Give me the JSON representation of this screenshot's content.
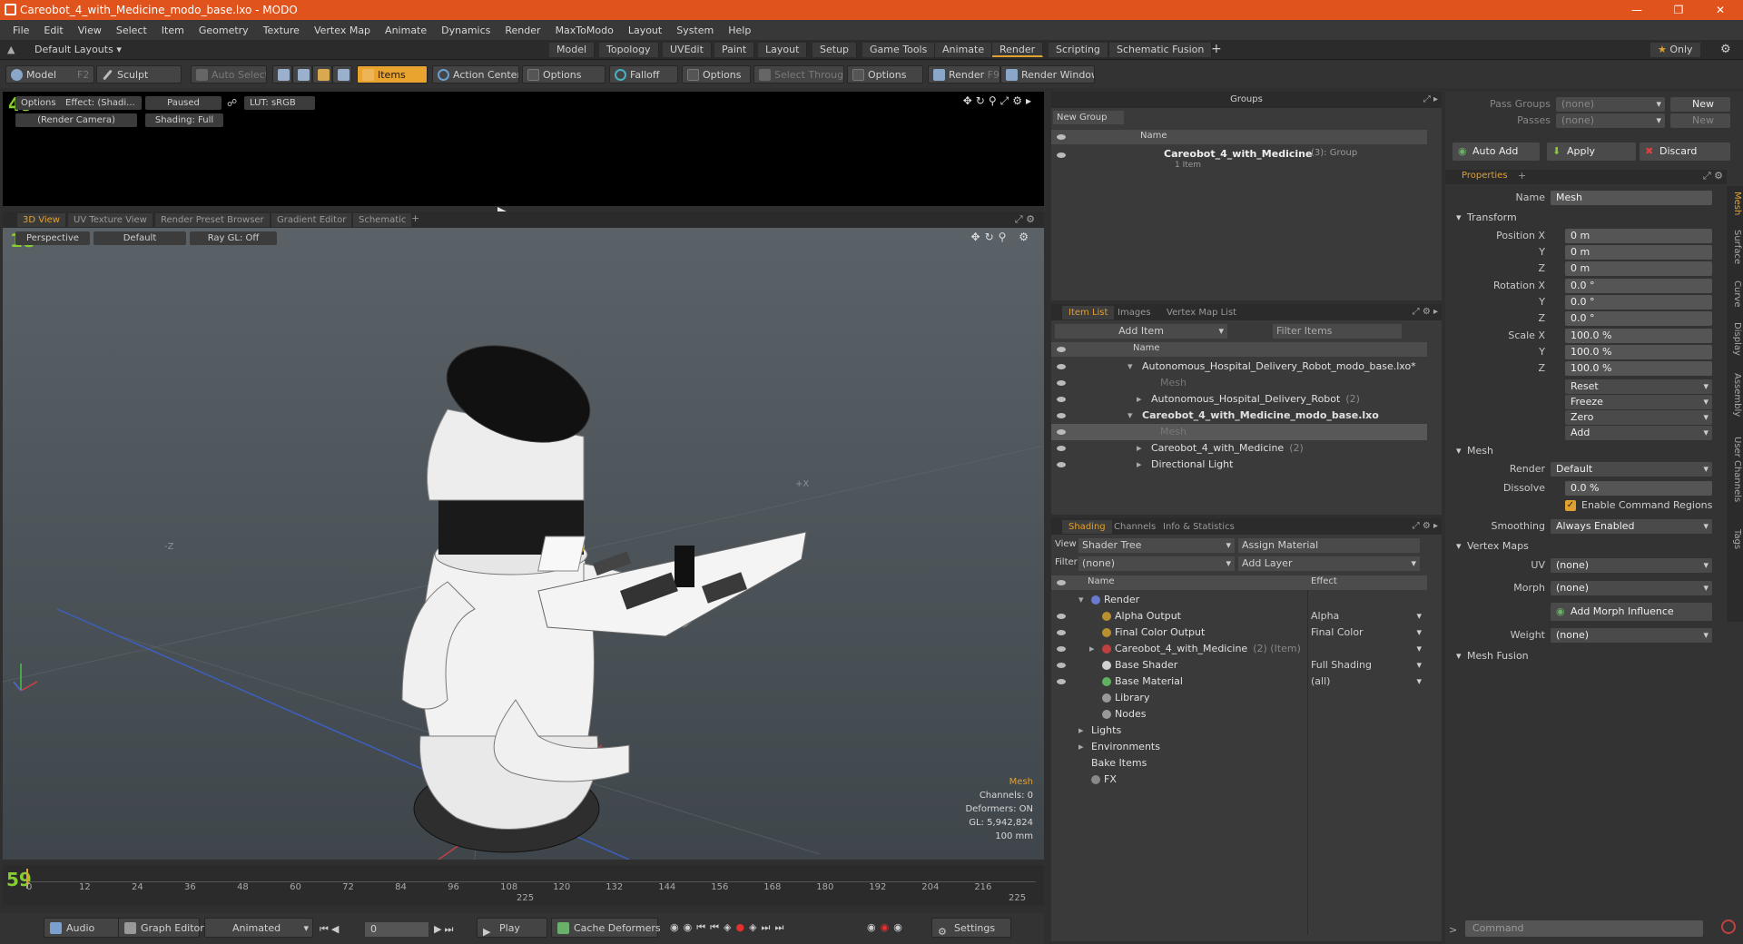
{
  "app": {
    "title": "Careobot_4_with_Medicine_modo_base.lxo - MODO",
    "menu": [
      "File",
      "Edit",
      "View",
      "Select",
      "Item",
      "Geometry",
      "Texture",
      "Vertex Map",
      "Animate",
      "Dynamics",
      "Render",
      "MaxToModo",
      "Layout",
      "System",
      "Help"
    ]
  },
  "layout": {
    "preset": "Default Layouts",
    "tabs": [
      "Model",
      "Topology",
      "UVEdit",
      "Paint",
      "Layout",
      "Setup",
      "Game Tools",
      "Animate",
      "Render",
      "Scripting",
      "Schematic Fusion"
    ],
    "active_tab": "Render",
    "only_label": "Only"
  },
  "toolbar": {
    "model": "Model",
    "model_key": "F2",
    "sculpt": "Sculpt",
    "auto_select": "Auto Select",
    "items": "Items",
    "action_center": "Action Center",
    "options1": "Options",
    "falloff": "Falloff",
    "options2": "Options",
    "select_through": "Select Through",
    "options3": "Options",
    "render": "Render",
    "render_key": "F9",
    "render_window": "Render Window"
  },
  "render_preview": {
    "options": "Options",
    "effect": "Effect: (Shadi...",
    "status": "Paused",
    "lut": "LUT: sRGB",
    "camera": "(Render Camera)",
    "shading": "Shading: Full",
    "frame_counter": "49"
  },
  "viewport_tabs": [
    "3D View",
    "UV Texture View",
    "Render Preset Browser",
    "Gradient Editor",
    "Schematic"
  ],
  "viewport": {
    "projection": "Perspective",
    "style": "Default",
    "raygl": "Ray GL: Off",
    "frame_counter": "18",
    "axis_z": "-Z",
    "axis_x": "+X",
    "stats": {
      "title": "Mesh",
      "channels": "Channels: 0",
      "deformers": "Deformers: ON",
      "gl": "GL: 5,942,824",
      "scale": "100 mm"
    }
  },
  "timeline": {
    "ticks": [
      "0",
      "12",
      "24",
      "36",
      "48",
      "60",
      "72",
      "84",
      "96",
      "108",
      "120",
      "132",
      "144",
      "156",
      "168",
      "180",
      "192",
      "204",
      "216"
    ],
    "end_mid": "225",
    "end_right": "225",
    "counter": "59"
  },
  "bottombar": {
    "audio": "Audio",
    "graph_editor": "Graph Editor",
    "animated": "Animated",
    "frame": "0",
    "play": "Play",
    "cache_deformers": "Cache Deformers",
    "settings": "Settings"
  },
  "groups": {
    "title": "Groups",
    "new_group": "New Group",
    "col_name": "Name",
    "item_name": "Careobot_4_with_Medicine",
    "item_count": "(3)",
    "item_type": ": Group",
    "item_sub": "1 Item"
  },
  "itemlist": {
    "tabs": [
      "Item List",
      "Images",
      "Vertex Map List"
    ],
    "add_item": "Add Item",
    "filter": "Filter Items",
    "col_name": "Name",
    "rows": [
      {
        "label": "Autonomous_Hospital_Delivery_Robot_modo_base.lxo*",
        "extra": "",
        "indent": 0,
        "bold": false,
        "selected": false,
        "dim": false
      },
      {
        "label": "Mesh",
        "extra": "",
        "indent": 2,
        "bold": false,
        "selected": false,
        "dim": true
      },
      {
        "label": "Autonomous_Hospital_Delivery_Robot",
        "extra": "(2)",
        "indent": 1,
        "bold": false,
        "selected": false,
        "dim": false
      },
      {
        "label": "Careobot_4_with_Medicine_modo_base.lxo",
        "extra": "",
        "indent": 0,
        "bold": true,
        "selected": false,
        "dim": false
      },
      {
        "label": "Mesh",
        "extra": "",
        "indent": 2,
        "bold": false,
        "selected": true,
        "dim": true
      },
      {
        "label": "Careobot_4_with_Medicine",
        "extra": "(2)",
        "indent": 1,
        "bold": false,
        "selected": false,
        "dim": false
      },
      {
        "label": "Directional Light",
        "extra": "",
        "indent": 1,
        "bold": false,
        "selected": false,
        "dim": false
      }
    ]
  },
  "shading": {
    "tabs": [
      "Shading",
      "Channels",
      "Info & Statistics"
    ],
    "view_label": "View",
    "view_value": "Shader Tree",
    "assign_material": "Assign Material",
    "filter_label": "Filter",
    "filter_value": "(none)",
    "add_layer": "Add Layer",
    "col_name": "Name",
    "col_effect": "Effect",
    "rows": [
      {
        "label": "Render",
        "effect": "",
        "indent": 0,
        "icon": "#6a7ad0"
      },
      {
        "label": "Alpha Output",
        "effect": "Alpha",
        "indent": 1,
        "icon": "#b89030"
      },
      {
        "label": "Final Color Output",
        "effect": "Final Color",
        "indent": 1,
        "icon": "#b89030"
      },
      {
        "label": "Careobot_4_with_Medicine",
        "extra": "(2) (Item)",
        "effect": "",
        "indent": 1,
        "icon": "#c04040"
      },
      {
        "label": "Base Shader",
        "effect": "Full Shading",
        "indent": 1,
        "icon": "#d0d0d0"
      },
      {
        "label": "Base Material",
        "effect": "(all)",
        "indent": 1,
        "icon": "#60b060"
      },
      {
        "label": "Library",
        "effect": "",
        "indent": 1,
        "icon": "#999"
      },
      {
        "label": "Nodes",
        "effect": "",
        "indent": 1,
        "icon": "#999"
      },
      {
        "label": "Lights",
        "effect": "",
        "indent": 0,
        "icon": ""
      },
      {
        "label": "Environments",
        "effect": "",
        "indent": 0,
        "icon": ""
      },
      {
        "label": "Bake Items",
        "effect": "",
        "indent": 0,
        "icon": ""
      },
      {
        "label": "FX",
        "effect": "",
        "indent": 0,
        "icon": "#888"
      }
    ]
  },
  "properties": {
    "pass_groups_label": "Pass Groups",
    "pass_groups_value": "(none)",
    "passes_label": "Passes",
    "passes_value": "(none)",
    "new1": "New",
    "new2": "New",
    "auto_add": "Auto Add",
    "apply": "Apply",
    "discard": "Discard",
    "tab": "Properties",
    "name_label": "Name",
    "name_value": "Mesh",
    "transform": "Transform",
    "position_label": "Position X",
    "rotation_label": "Rotation X",
    "scale_label": "Scale X",
    "y_label": "Y",
    "z_label": "Z",
    "pos": [
      "0 m",
      "0 m",
      "0 m"
    ],
    "rot": [
      "0.0 °",
      "0.0 °",
      "0.0 °"
    ],
    "scl": [
      "100.0 %",
      "100.0 %",
      "100.0 %"
    ],
    "reset": "Reset",
    "freeze": "Freeze",
    "zero": "Zero",
    "add": "Add",
    "mesh_section": "Mesh",
    "render_label": "Render",
    "render_value": "Default",
    "dissolve_label": "Dissolve",
    "dissolve_value": "0.0 %",
    "enable_cmd": "Enable Command Regions",
    "smoothing_label": "Smoothing",
    "smoothing_value": "Always Enabled",
    "vertex_maps": "Vertex Maps",
    "uv_label": "UV",
    "uv_value": "(none)",
    "morph_label": "Morph",
    "morph_value": "(none)",
    "add_morph": "Add Morph Influence",
    "weight_label": "Weight",
    "weight_value": "(none)",
    "mesh_fusion": "Mesh Fusion",
    "side_tabs": [
      "Mesh",
      "Surface",
      "Curve",
      "Display",
      "Assembly",
      "User Channels",
      "Tags"
    ],
    "command_placeholder": "Command"
  }
}
